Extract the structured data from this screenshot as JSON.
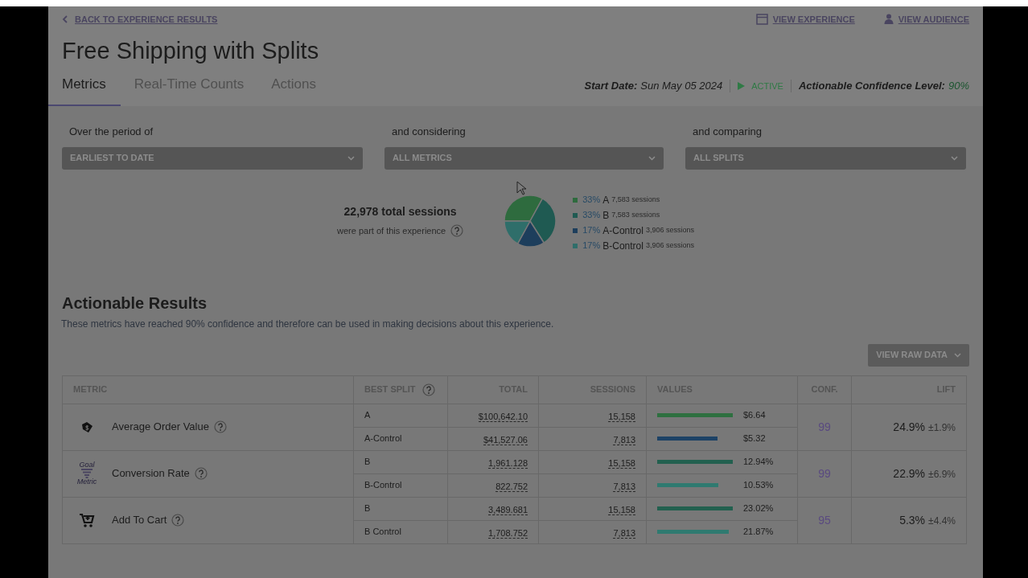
{
  "header": {
    "back_link": "BACK TO EXPERIENCE RESULTS",
    "links": [
      {
        "kind": "window",
        "label": "VIEW EXPERIENCE"
      },
      {
        "kind": "person",
        "label": "VIEW AUDIENCE"
      }
    ],
    "title": "Free Shipping with Splits",
    "tabs": [
      {
        "label": "Metrics",
        "selected": true
      },
      {
        "label": "Real-Time Counts",
        "selected": false
      },
      {
        "label": "Actions",
        "selected": false
      }
    ],
    "status": {
      "start_label": "Start Date:",
      "start_value": "Sun May 05 2024",
      "state": "ACTIVE",
      "active": true,
      "confidence_label": "Actionable Confidence Level:",
      "confidence_value": "90%"
    }
  },
  "filters": [
    {
      "label": "Over the period of",
      "value": "EARLIEST TO DATE"
    },
    {
      "label": "and considering",
      "value": "ALL METRICS"
    },
    {
      "label": "and comparing",
      "value": "ALL SPLITS"
    }
  ],
  "sessions": {
    "total": "22,978 total sessions",
    "caption": "were part of this experience",
    "legend": [
      {
        "percent": "33%",
        "name": "A",
        "sessions": "7,583 sessions",
        "color": "#2e6b3e"
      },
      {
        "percent": "33%",
        "name": "B",
        "sessions": "7,583 sessions",
        "color": "#1f5a52"
      },
      {
        "percent": "17%",
        "name": "A-Control",
        "sessions": "3,906 sessions",
        "color": "#1d3e5c"
      },
      {
        "percent": "17%",
        "name": "B-Control",
        "sessions": "3,906 sessions",
        "color": "#2f6e6a"
      }
    ]
  },
  "results": {
    "title": "Actionable Results",
    "description": "These metrics have reached 90% confidence and therefore can be used in making decisions about this experience.",
    "raw_data_button": "VIEW RAW DATA",
    "columns": [
      "METRIC",
      "BEST SPLIT",
      "TOTAL",
      "SESSIONS",
      "VALUES",
      "CONF.",
      "LIFT"
    ],
    "metrics": [
      {
        "kind": "tag",
        "name": "Average Order Value",
        "conf": "99",
        "lift": "24.9%",
        "margin": "±1.9%",
        "splits": [
          {
            "split": "A",
            "total": "$100,642.10",
            "sessions": "15,158",
            "value": "$6.64",
            "color": "#2e7040"
          },
          {
            "split": "A-Control",
            "total": "$41,527.06",
            "sessions": "7,813",
            "value": "$5.32",
            "color": "#1d4266"
          }
        ]
      },
      {
        "kind": "funnel",
        "icon_top": "Goal",
        "icon_bottom": "Metric",
        "name": "Conversion Rate",
        "conf": "99",
        "lift": "22.9%",
        "margin": "±6.9%",
        "splits": [
          {
            "split": "B",
            "total": "1,961.128",
            "sessions": "15,158",
            "value": "12.94%",
            "color": "#22604f"
          },
          {
            "split": "B-Control",
            "total": "822.752",
            "sessions": "7,813",
            "value": "10.53%",
            "color": "#2f7a70"
          }
        ]
      },
      {
        "kind": "cart",
        "name": "Add To Cart",
        "conf": "95",
        "lift": "5.3%",
        "margin": "±4.4%",
        "splits": [
          {
            "split": "B",
            "total": "3,489.681",
            "sessions": "15,158",
            "value": "23.02%",
            "color": "#22604f"
          },
          {
            "split": "B Control",
            "total": "1,708.752",
            "sessions": "7,813",
            "value": "21.87%",
            "color": "#2f7a70"
          }
        ]
      }
    ]
  }
}
